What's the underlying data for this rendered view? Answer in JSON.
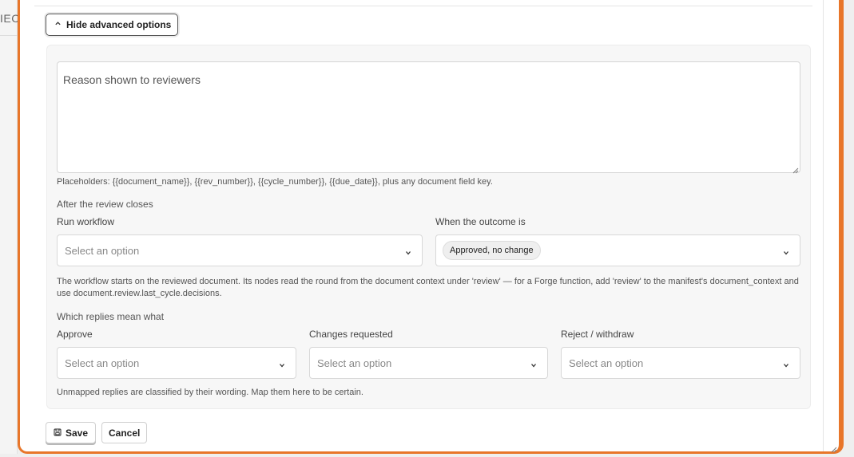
{
  "background": {
    "fragment_text": "IEC"
  },
  "advanced": {
    "toggle_label": "Hide advanced options",
    "reason_placeholder": "Reason shown to reviewers",
    "placeholders_help": "Placeholders: {{document_name}}, {{rev_number}}, {{cycle_number}}, {{due_date}}, plus any document field key.",
    "after_review_heading": "After the review closes",
    "run_workflow": {
      "label": "Run workflow",
      "placeholder": "Select an option"
    },
    "outcome": {
      "label": "When the outcome is",
      "selected_chip": "Approved, no change"
    },
    "workflow_help": "The workflow starts on the reviewed document. Its nodes read the round from the document context under 'review' — for a Forge function, add 'review' to the manifest's document_context and use document.review.last_cycle.decisions.",
    "replies_heading": "Which replies mean what",
    "approve": {
      "label": "Approve",
      "placeholder": "Select an option"
    },
    "changes": {
      "label": "Changes requested",
      "placeholder": "Select an option"
    },
    "reject": {
      "label": "Reject / withdraw",
      "placeholder": "Select an option"
    },
    "unmapped_help": "Unmapped replies are classified by their wording. Map them here to be certain."
  },
  "actions": {
    "save_label": "Save",
    "cancel_label": "Cancel"
  },
  "colors": {
    "accent": "#e8762a",
    "advanced_bg": "#f7f7f7"
  },
  "icons": [
    "chevron-up-icon",
    "chevron-down-icon",
    "save-icon",
    "resize-grip-icon"
  ]
}
